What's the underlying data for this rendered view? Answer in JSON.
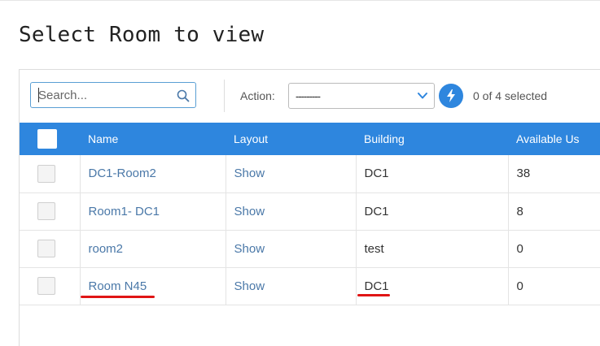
{
  "page": {
    "title": "Select Room to view"
  },
  "toolbar": {
    "search_placeholder": "Search...",
    "search_value": "",
    "action_label": "Action:",
    "action_value": "---------",
    "selected_count": "0 of 4 selected"
  },
  "colors": {
    "accent": "#2e86de",
    "link": "#4a78a8",
    "highlight_underline": "#e01515"
  },
  "table": {
    "columns": [
      "Name",
      "Layout",
      "Building",
      "Available Us"
    ],
    "rows": [
      {
        "name": "DC1-Room2",
        "layout": "Show",
        "building": "DC1",
        "available_us": "38"
      },
      {
        "name": "Room1- DC1",
        "layout": "Show",
        "building": "DC1",
        "available_us": "8"
      },
      {
        "name": "room2",
        "layout": "Show",
        "building": "test",
        "available_us": "0"
      },
      {
        "name": "Room N45",
        "layout": "Show",
        "building": "DC1",
        "available_us": "0"
      }
    ]
  }
}
